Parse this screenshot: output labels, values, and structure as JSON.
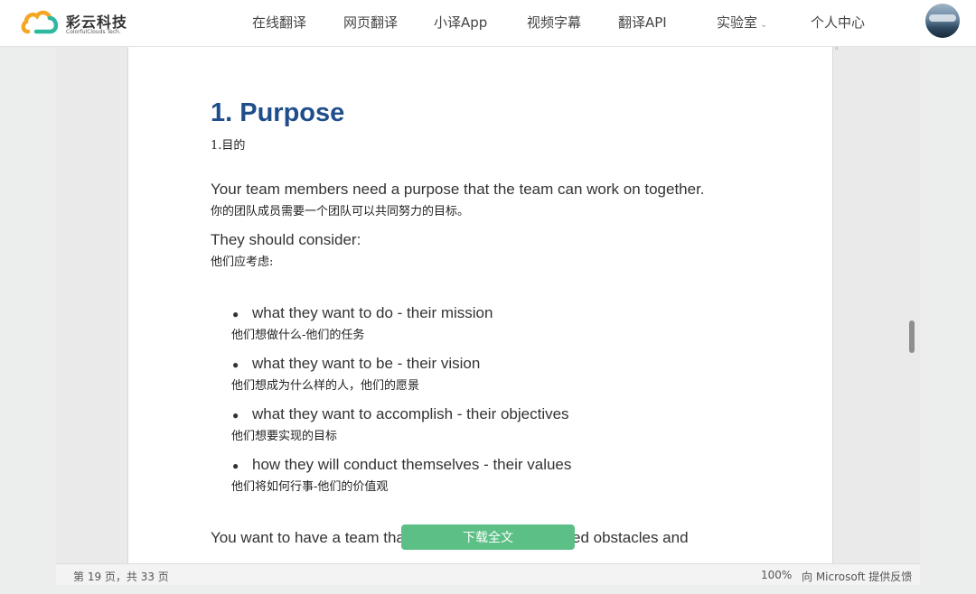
{
  "brand": {
    "name": "彩云科技",
    "tagline": "ColorfulClouds Tech.",
    "logo_colors": [
      "#f5a623",
      "#2fb8a0"
    ]
  },
  "nav": {
    "items": [
      {
        "label": "在线翻译"
      },
      {
        "label": "网页翻译"
      },
      {
        "label": "小译App"
      },
      {
        "label": "视频字幕"
      },
      {
        "label": "翻译API"
      },
      {
        "label": "实验室",
        "has_dropdown": true
      },
      {
        "label": "个人中心"
      }
    ],
    "avatar_icon": "user-avatar"
  },
  "document": {
    "heading": "1. Purpose",
    "heading_zh": "1.目的",
    "heading_color": "#1f4e8c",
    "para1": "Your team members need a purpose that the team can work on together.",
    "para1_zh": "你的团队成员需要一个团队可以共同努力的目标。",
    "para2": "They should consider:",
    "para2_zh": "他们应考虑:",
    "bullets": [
      {
        "text": "what they want to do - their mission",
        "zh": "他们想做什么-他们的任务"
      },
      {
        "text": "what they want to be - their vision",
        "zh": "他们想成为什么样的人，他们的愿景"
      },
      {
        "text": "what they want to accomplish - their objectives",
        "zh": "他们想要实现的目标"
      },
      {
        "text": "how they will conduct themselves - their values",
        "zh": "他们将如何行事-他们的价值观"
      }
    ],
    "para3_start": "You want to have a team tha",
    "para3_end": "ed obstacles and"
  },
  "download_button": {
    "label": "下载全文",
    "color": "#5cbf85"
  },
  "status_bar": {
    "page_info": "第 19 页，共 33 页",
    "zoom": "100%",
    "feedback": "向 Microsoft 提供反馈"
  }
}
